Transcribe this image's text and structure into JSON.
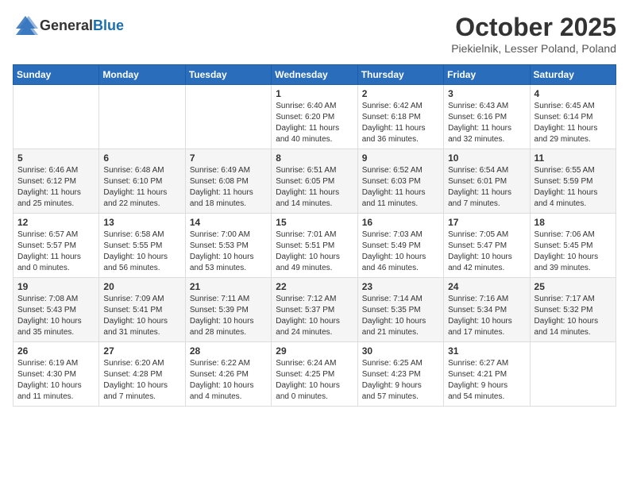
{
  "logo": {
    "general": "General",
    "blue": "Blue"
  },
  "header": {
    "month": "October 2025",
    "location": "Piekielnik, Lesser Poland, Poland"
  },
  "weekdays": [
    "Sunday",
    "Monday",
    "Tuesday",
    "Wednesday",
    "Thursday",
    "Friday",
    "Saturday"
  ],
  "weeks": [
    [
      {
        "day": "",
        "info": ""
      },
      {
        "day": "",
        "info": ""
      },
      {
        "day": "",
        "info": ""
      },
      {
        "day": "1",
        "info": "Sunrise: 6:40 AM\nSunset: 6:20 PM\nDaylight: 11 hours\nand 40 minutes."
      },
      {
        "day": "2",
        "info": "Sunrise: 6:42 AM\nSunset: 6:18 PM\nDaylight: 11 hours\nand 36 minutes."
      },
      {
        "day": "3",
        "info": "Sunrise: 6:43 AM\nSunset: 6:16 PM\nDaylight: 11 hours\nand 32 minutes."
      },
      {
        "day": "4",
        "info": "Sunrise: 6:45 AM\nSunset: 6:14 PM\nDaylight: 11 hours\nand 29 minutes."
      }
    ],
    [
      {
        "day": "5",
        "info": "Sunrise: 6:46 AM\nSunset: 6:12 PM\nDaylight: 11 hours\nand 25 minutes."
      },
      {
        "day": "6",
        "info": "Sunrise: 6:48 AM\nSunset: 6:10 PM\nDaylight: 11 hours\nand 22 minutes."
      },
      {
        "day": "7",
        "info": "Sunrise: 6:49 AM\nSunset: 6:08 PM\nDaylight: 11 hours\nand 18 minutes."
      },
      {
        "day": "8",
        "info": "Sunrise: 6:51 AM\nSunset: 6:05 PM\nDaylight: 11 hours\nand 14 minutes."
      },
      {
        "day": "9",
        "info": "Sunrise: 6:52 AM\nSunset: 6:03 PM\nDaylight: 11 hours\nand 11 minutes."
      },
      {
        "day": "10",
        "info": "Sunrise: 6:54 AM\nSunset: 6:01 PM\nDaylight: 11 hours\nand 7 minutes."
      },
      {
        "day": "11",
        "info": "Sunrise: 6:55 AM\nSunset: 5:59 PM\nDaylight: 11 hours\nand 4 minutes."
      }
    ],
    [
      {
        "day": "12",
        "info": "Sunrise: 6:57 AM\nSunset: 5:57 PM\nDaylight: 11 hours\nand 0 minutes."
      },
      {
        "day": "13",
        "info": "Sunrise: 6:58 AM\nSunset: 5:55 PM\nDaylight: 10 hours\nand 56 minutes."
      },
      {
        "day": "14",
        "info": "Sunrise: 7:00 AM\nSunset: 5:53 PM\nDaylight: 10 hours\nand 53 minutes."
      },
      {
        "day": "15",
        "info": "Sunrise: 7:01 AM\nSunset: 5:51 PM\nDaylight: 10 hours\nand 49 minutes."
      },
      {
        "day": "16",
        "info": "Sunrise: 7:03 AM\nSunset: 5:49 PM\nDaylight: 10 hours\nand 46 minutes."
      },
      {
        "day": "17",
        "info": "Sunrise: 7:05 AM\nSunset: 5:47 PM\nDaylight: 10 hours\nand 42 minutes."
      },
      {
        "day": "18",
        "info": "Sunrise: 7:06 AM\nSunset: 5:45 PM\nDaylight: 10 hours\nand 39 minutes."
      }
    ],
    [
      {
        "day": "19",
        "info": "Sunrise: 7:08 AM\nSunset: 5:43 PM\nDaylight: 10 hours\nand 35 minutes."
      },
      {
        "day": "20",
        "info": "Sunrise: 7:09 AM\nSunset: 5:41 PM\nDaylight: 10 hours\nand 31 minutes."
      },
      {
        "day": "21",
        "info": "Sunrise: 7:11 AM\nSunset: 5:39 PM\nDaylight: 10 hours\nand 28 minutes."
      },
      {
        "day": "22",
        "info": "Sunrise: 7:12 AM\nSunset: 5:37 PM\nDaylight: 10 hours\nand 24 minutes."
      },
      {
        "day": "23",
        "info": "Sunrise: 7:14 AM\nSunset: 5:35 PM\nDaylight: 10 hours\nand 21 minutes."
      },
      {
        "day": "24",
        "info": "Sunrise: 7:16 AM\nSunset: 5:34 PM\nDaylight: 10 hours\nand 17 minutes."
      },
      {
        "day": "25",
        "info": "Sunrise: 7:17 AM\nSunset: 5:32 PM\nDaylight: 10 hours\nand 14 minutes."
      }
    ],
    [
      {
        "day": "26",
        "info": "Sunrise: 6:19 AM\nSunset: 4:30 PM\nDaylight: 10 hours\nand 11 minutes."
      },
      {
        "day": "27",
        "info": "Sunrise: 6:20 AM\nSunset: 4:28 PM\nDaylight: 10 hours\nand 7 minutes."
      },
      {
        "day": "28",
        "info": "Sunrise: 6:22 AM\nSunset: 4:26 PM\nDaylight: 10 hours\nand 4 minutes."
      },
      {
        "day": "29",
        "info": "Sunrise: 6:24 AM\nSunset: 4:25 PM\nDaylight: 10 hours\nand 0 minutes."
      },
      {
        "day": "30",
        "info": "Sunrise: 6:25 AM\nSunset: 4:23 PM\nDaylight: 9 hours\nand 57 minutes."
      },
      {
        "day": "31",
        "info": "Sunrise: 6:27 AM\nSunset: 4:21 PM\nDaylight: 9 hours\nand 54 minutes."
      },
      {
        "day": "",
        "info": ""
      }
    ]
  ]
}
